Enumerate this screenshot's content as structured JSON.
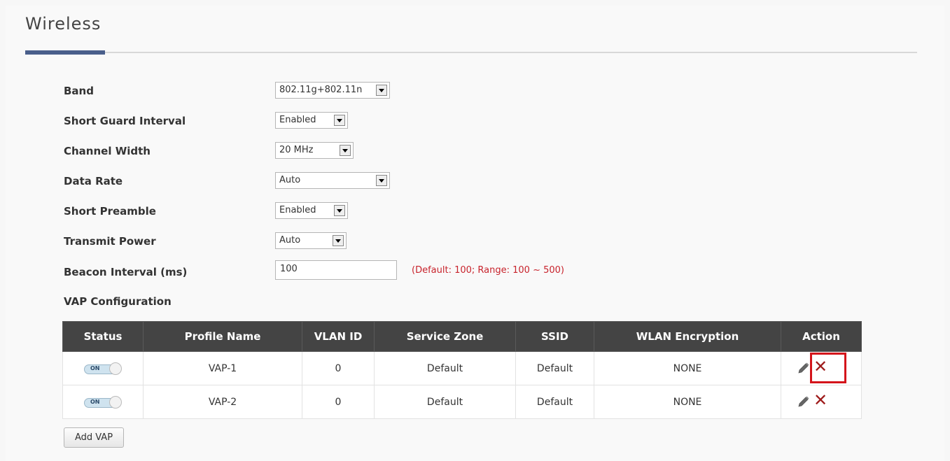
{
  "page": {
    "title": "Wireless"
  },
  "fields": {
    "band": {
      "label": "Band",
      "value": "802.11g+802.11n"
    },
    "sgi": {
      "label": "Short Guard Interval",
      "value": "Enabled"
    },
    "channel_width": {
      "label": "Channel Width",
      "value": "20 MHz"
    },
    "data_rate": {
      "label": "Data Rate",
      "value": "Auto"
    },
    "short_preamble": {
      "label": "Short Preamble",
      "value": "Enabled"
    },
    "transmit_power": {
      "label": "Transmit Power",
      "value": "Auto"
    },
    "beacon_interval": {
      "label": "Beacon Interval (ms)",
      "value": "100",
      "hint": "(Default: 100; Range: 100 ~ 500)"
    }
  },
  "vap": {
    "heading": "VAP Configuration",
    "columns": [
      "Status",
      "Profile Name",
      "VLAN ID",
      "Service Zone",
      "SSID",
      "WLAN Encryption",
      "Action"
    ],
    "rows": [
      {
        "status": "ON",
        "profile": "VAP-1",
        "vlan": "0",
        "zone": "Default",
        "ssid": "Default",
        "enc": "NONE"
      },
      {
        "status": "ON",
        "profile": "VAP-2",
        "vlan": "0",
        "zone": "Default",
        "ssid": "Default",
        "enc": "NONE"
      }
    ],
    "add_label": "Add VAP"
  },
  "colors": {
    "accent": "#4a5f8b",
    "header_bg": "#444444",
    "hint": "#c8232c",
    "delete": "#9e1b1b",
    "highlight": "#d4141b"
  },
  "icons": {
    "edit": "pencil-icon",
    "delete": "delete-x-icon",
    "dropdown": "chevron-down-icon"
  }
}
